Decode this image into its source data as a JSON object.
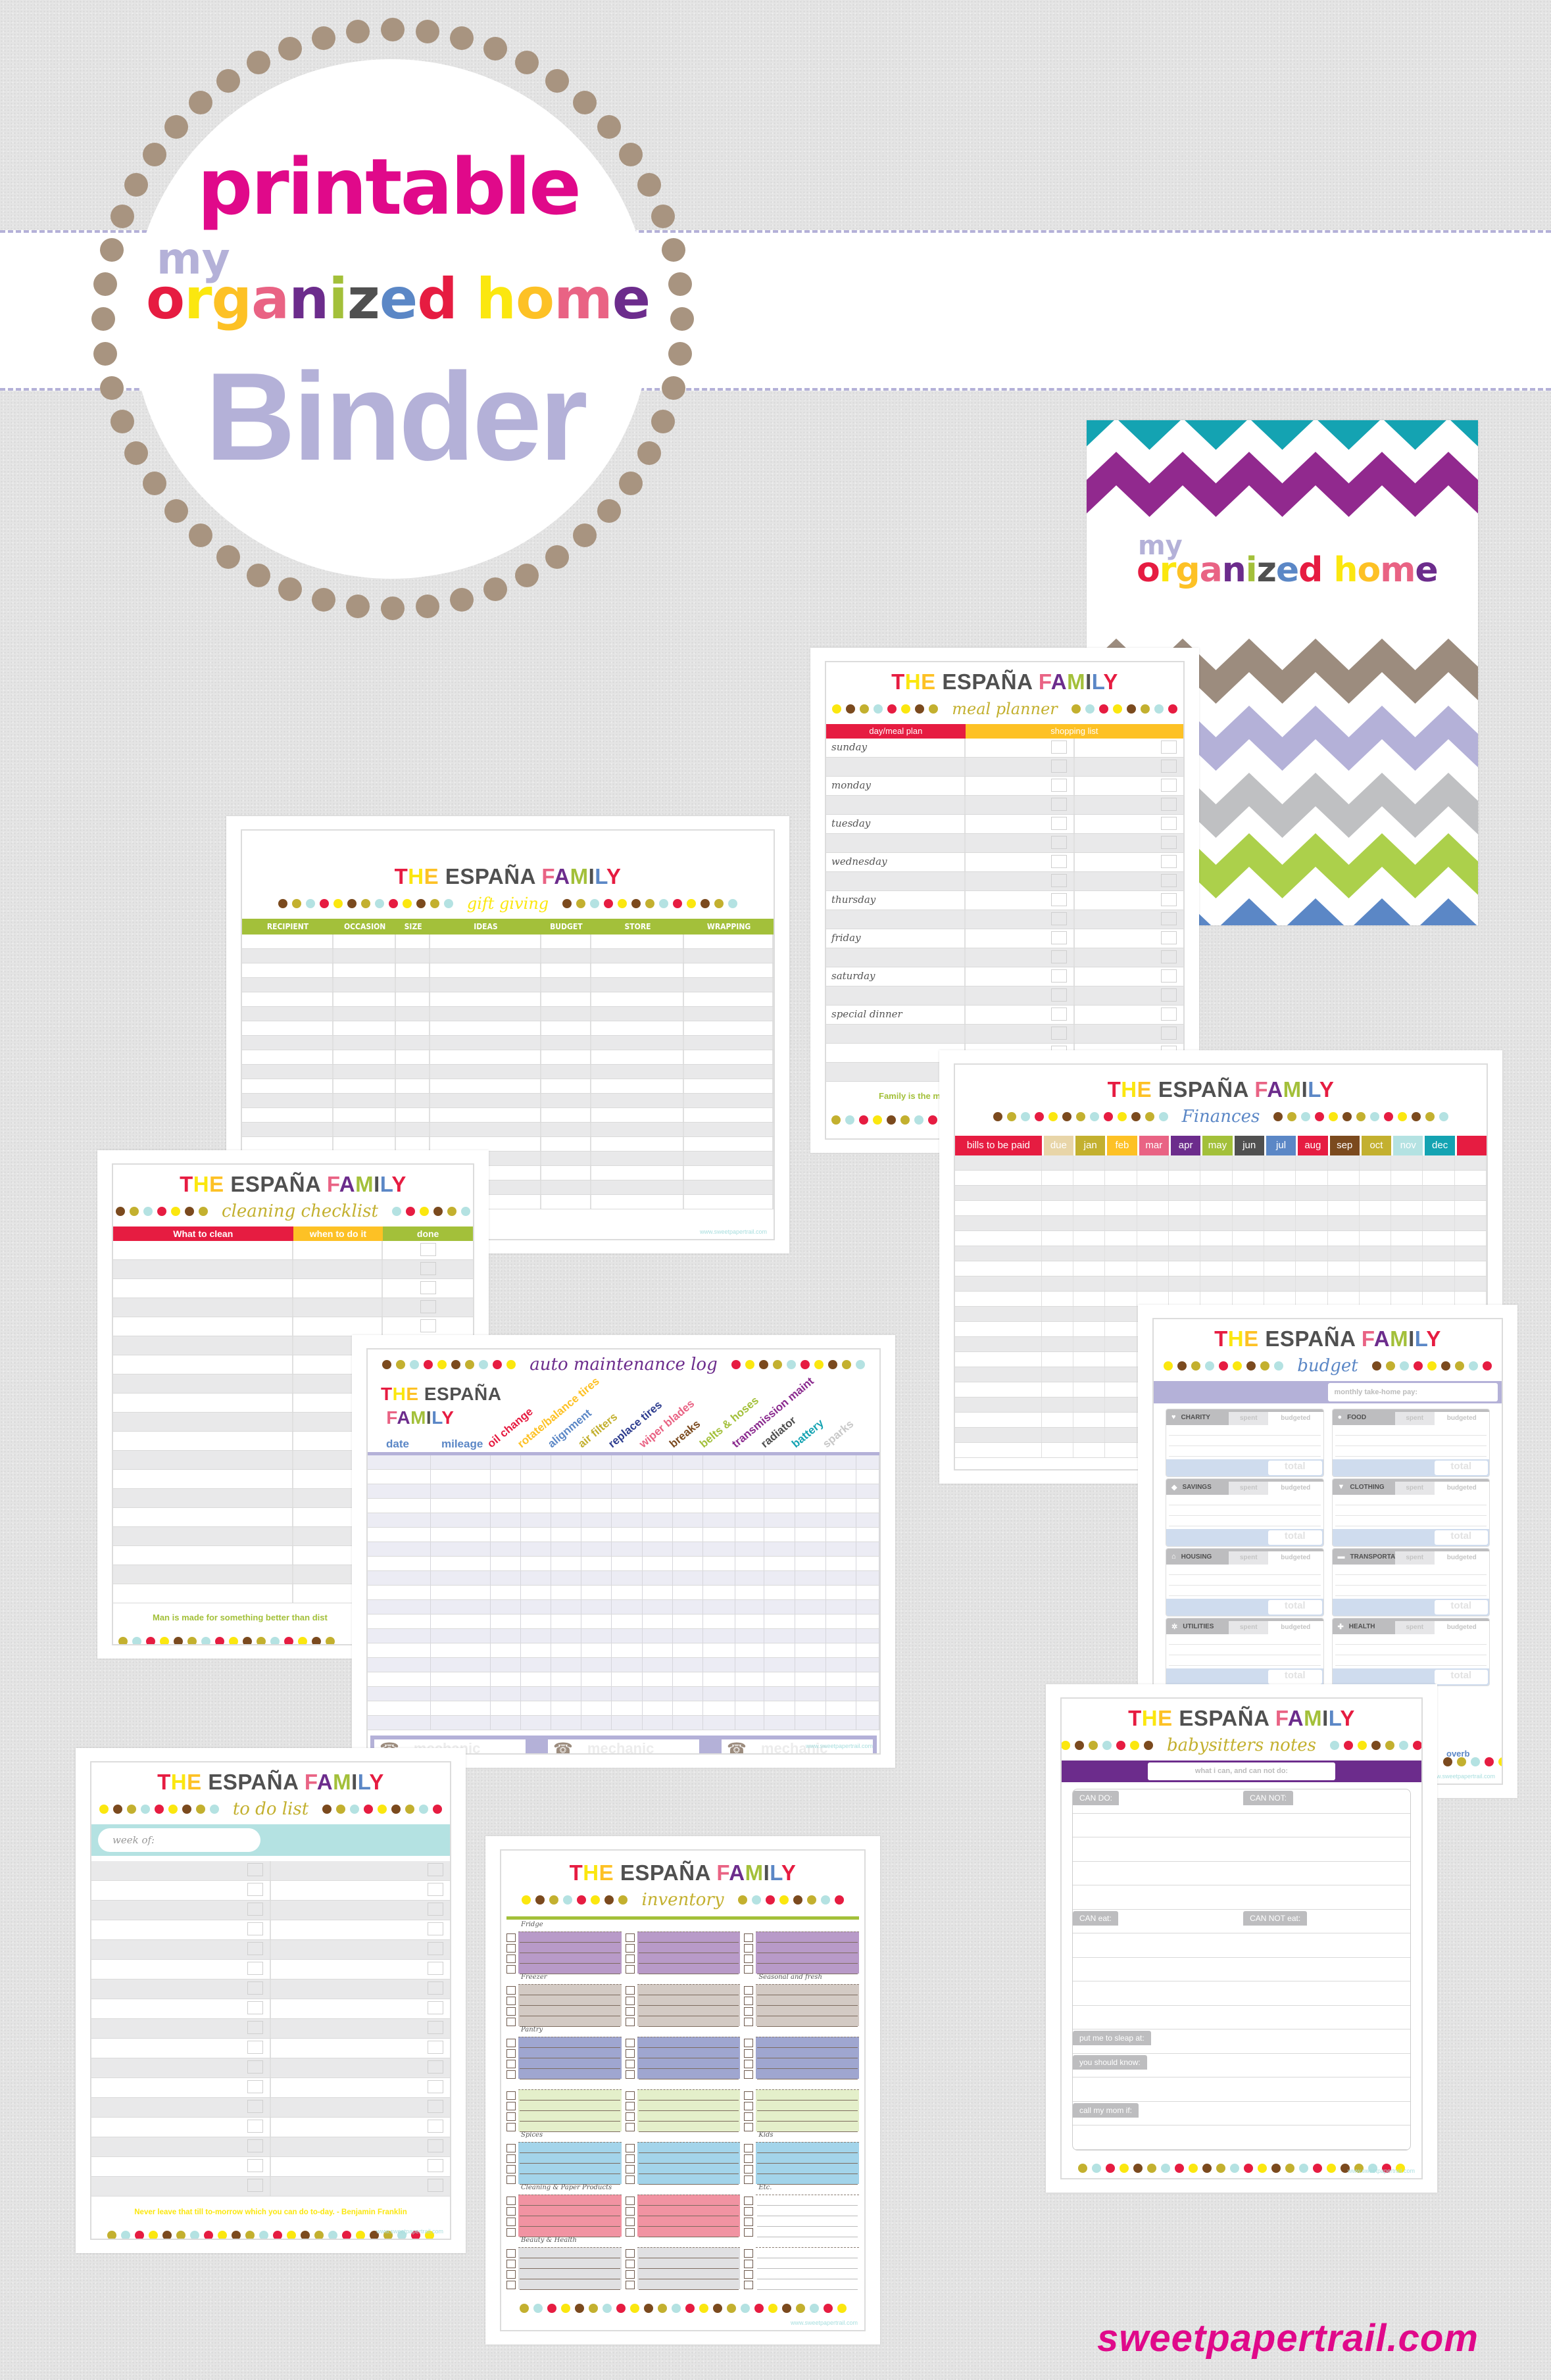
{
  "colors": {
    "red": "#e61c41",
    "yellow": "#fbe70f",
    "orange": "#fdc125",
    "pink": "#e96384",
    "purple": "#6c2c8c",
    "green": "#a3c03a",
    "gray": "#505050",
    "blue": "#5b87c6",
    "brown": "#7b4a1e",
    "olive": "#c3b02f",
    "aqua": "#b4e2e2",
    "teal": "#14a3b2",
    "lavender": "#b4b1d8",
    "magenta": "#e0098a",
    "ring": "#a89480"
  },
  "dot_sequence": [
    "#7b4a1e",
    "#c3b02f",
    "#b4e2e2",
    "#e61c41",
    "#fbe70f"
  ],
  "logo": {
    "printable": "printable",
    "my": "my",
    "organized_home_letters": [
      {
        "ch": "o",
        "color": "#e61c41"
      },
      {
        "ch": "r",
        "color": "#fbe70f"
      },
      {
        "ch": "g",
        "color": "#fdc125"
      },
      {
        "ch": "a",
        "color": "#e96384"
      },
      {
        "ch": "n",
        "color": "#6c2c8c"
      },
      {
        "ch": "i",
        "color": "#a3c03a"
      },
      {
        "ch": "z",
        "color": "#505050"
      },
      {
        "ch": "e",
        "color": "#5b87c6"
      },
      {
        "ch": "d",
        "color": "#e61c41"
      },
      {
        "ch": " ",
        "color": "#ffffff"
      },
      {
        "ch": "h",
        "color": "#fbe70f"
      },
      {
        "ch": "o",
        "color": "#fdc125"
      },
      {
        "ch": "m",
        "color": "#e96384"
      },
      {
        "ch": "e",
        "color": "#6c2c8c"
      }
    ],
    "binder": "Binder"
  },
  "family_title_letters": [
    {
      "ch": "T",
      "color": "#e61c41"
    },
    {
      "ch": "H",
      "color": "#fbe70f"
    },
    {
      "ch": "E",
      "color": "#fdc125"
    },
    {
      "ch": " ",
      "color": "#505050"
    },
    {
      "ch": "E",
      "color": "#505050"
    },
    {
      "ch": "S",
      "color": "#505050"
    },
    {
      "ch": "P",
      "color": "#505050"
    },
    {
      "ch": "A",
      "color": "#505050"
    },
    {
      "ch": "Ñ",
      "color": "#505050"
    },
    {
      "ch": "A",
      "color": "#505050"
    },
    {
      "ch": " ",
      "color": "#505050"
    },
    {
      "ch": "F",
      "color": "#e96384"
    },
    {
      "ch": "A",
      "color": "#6c2c8c"
    },
    {
      "ch": "M",
      "color": "#a3c03a"
    },
    {
      "ch": "I",
      "color": "#505050"
    },
    {
      "ch": "L",
      "color": "#5b87c6"
    },
    {
      "ch": "Y",
      "color": "#e61c41"
    }
  ],
  "site": "www.sweetpapertrail.com",
  "brand": "sweetpapertrail.com",
  "cover": {
    "my": "my",
    "chevrons": [
      "#14a3b2",
      "#91298e",
      "#9c8c7e",
      "#b4b1d8",
      "#bfc0c2",
      "#acd04b",
      "#5b87c6"
    ]
  },
  "meal_planner": {
    "title": "meal planner",
    "col1": "day/meal plan",
    "col2": "shopping list",
    "days": [
      "sunday",
      "monday",
      "tuesday",
      "wednesday",
      "thursday",
      "friday",
      "saturday",
      "special dinner"
    ],
    "footer": "Family is the most"
  },
  "gift_giving": {
    "title": "gift giving",
    "columns": [
      "RECIPIENT",
      "OCCASION",
      "SIZE",
      "IDEAS",
      "BUDGET",
      "STORE",
      "WRAPPING"
    ]
  },
  "finances": {
    "title": "Finances",
    "columns": [
      {
        "label": "bills to be paid",
        "color": "#e61c41"
      },
      {
        "label": "due",
        "color": "#e8d5a8"
      },
      {
        "label": "jan",
        "color": "#c3b02f"
      },
      {
        "label": "feb",
        "color": "#fdc125"
      },
      {
        "label": "mar",
        "color": "#e96384"
      },
      {
        "label": "apr",
        "color": "#6c2c8c"
      },
      {
        "label": "may",
        "color": "#a3c03a"
      },
      {
        "label": "jun",
        "color": "#505050"
      },
      {
        "label": "jul",
        "color": "#5b87c6"
      },
      {
        "label": "aug",
        "color": "#e61c41"
      },
      {
        "label": "sep",
        "color": "#7b4a1e"
      },
      {
        "label": "oct",
        "color": "#c3b02f"
      },
      {
        "label": "nov",
        "color": "#b4e2e2"
      },
      {
        "label": "dec",
        "color": "#14a3b2"
      },
      {
        "label": "",
        "color": "#e61c41"
      }
    ]
  },
  "cleaning": {
    "title": "cleaning checklist",
    "columns": [
      {
        "label": "What to clean",
        "color": "#e61c41"
      },
      {
        "label": "when to do it",
        "color": "#fdc125"
      },
      {
        "label": "done",
        "color": "#a3c03a"
      }
    ],
    "quote": "Man is made for something better than dist"
  },
  "auto": {
    "title": "auto maintenance log",
    "date": "date",
    "mileage": "mileage",
    "items": [
      {
        "label": "oil change",
        "color": "#e61c41"
      },
      {
        "label": "rotate/balance tires",
        "color": "#fdc125"
      },
      {
        "label": "alignment",
        "color": "#5b87c6"
      },
      {
        "label": "air filters",
        "color": "#c3b02f"
      },
      {
        "label": "replace tires",
        "color": "#2e3d8f"
      },
      {
        "label": "wiper blades",
        "color": "#e96384"
      },
      {
        "label": "breaks",
        "color": "#7b4a1e"
      },
      {
        "label": "belts & hoses",
        "color": "#a3c03a"
      },
      {
        "label": "transmission maint",
        "color": "#8a2a8e"
      },
      {
        "label": "radiator",
        "color": "#505050"
      },
      {
        "label": "battery",
        "color": "#14a3b2"
      },
      {
        "label": "sparks",
        "color": "#c8c8c8"
      }
    ],
    "mechanic": [
      "mechanic",
      "mechanic",
      "mechanic"
    ]
  },
  "budget": {
    "title": "budget",
    "take_home": "monthly take-home pay:",
    "spent": "spent",
    "budgeted": "budgeted",
    "total": "total",
    "footer": "overb",
    "categories": [
      {
        "name": "CHARITY",
        "icon": "heart-icon",
        "glyph": "♥"
      },
      {
        "name": "FOOD",
        "icon": "apple-icon",
        "glyph": "●"
      },
      {
        "name": "SAVINGS",
        "icon": "piggy-bank-icon",
        "glyph": "◆"
      },
      {
        "name": "CLOTHING",
        "icon": "shirt-icon",
        "glyph": "▼"
      },
      {
        "name": "HOUSING",
        "icon": "house-icon",
        "glyph": "⌂"
      },
      {
        "name": "TRANSPORTATION",
        "icon": "car-icon",
        "glyph": "▬"
      },
      {
        "name": "UTILITIES",
        "icon": "gear-icon",
        "glyph": "✲"
      },
      {
        "name": "HEALTH",
        "icon": "stethoscope-icon",
        "glyph": "✚"
      }
    ]
  },
  "babysitters": {
    "title": "babysitters notes",
    "bar_label": "what i can, and can not do:",
    "rows": [
      [
        "CAN DO:",
        "CAN NOT:"
      ],
      [
        "",
        ""
      ],
      [
        "",
        ""
      ],
      [
        "",
        ""
      ],
      [
        "",
        ""
      ],
      [
        "CAN eat:",
        "CAN NOT eat:"
      ],
      [
        "",
        ""
      ],
      [
        "",
        ""
      ],
      [
        "",
        ""
      ],
      [
        "",
        ""
      ],
      [
        "put me to sleap at:",
        ""
      ],
      [
        "you should know:",
        ""
      ],
      [
        "",
        ""
      ],
      [
        "call my mom if:",
        ""
      ],
      [
        "",
        ""
      ]
    ]
  },
  "todo": {
    "title": "to do list",
    "week_of": "week of:",
    "quote": "Never leave that till to-morrow which you can do to-day. - Benjamin Franklin"
  },
  "inventory": {
    "title": "inventory",
    "sections": [
      {
        "labels": [
          "Fridge",
          "",
          ""
        ],
        "colors": [
          "#b89ac8",
          "#b89ac8",
          "#b89ac8"
        ]
      },
      {
        "labels": [
          "Freezer",
          "",
          "Seasonal and fresh"
        ],
        "colors": [
          "#d3cac4",
          "#d3cac4",
          "#d3cac4"
        ]
      },
      {
        "labels": [
          "Pantry",
          "",
          ""
        ],
        "colors": [
          "#9fa6d0",
          "#9fa6d0",
          "#9fa6d0"
        ]
      },
      {
        "labels": [
          "",
          "",
          ""
        ],
        "colors": [
          "#e4efca",
          "#e4efca",
          "#e4efca"
        ]
      },
      {
        "labels": [
          "Spices",
          "",
          "Kids"
        ],
        "colors": [
          "#a3d4ea",
          "#a3d4ea",
          "#a3d4ea"
        ]
      },
      {
        "labels": [
          "Cleaning & Paper Products",
          "",
          "Etc."
        ],
        "colors": [
          "#f193a2",
          "#f193a2",
          "#ffffff"
        ]
      },
      {
        "labels": [
          "Beauty & Health",
          "",
          ""
        ],
        "colors": [
          "#e0e0e2",
          "#e0e0e2",
          "#ffffff"
        ]
      }
    ]
  }
}
